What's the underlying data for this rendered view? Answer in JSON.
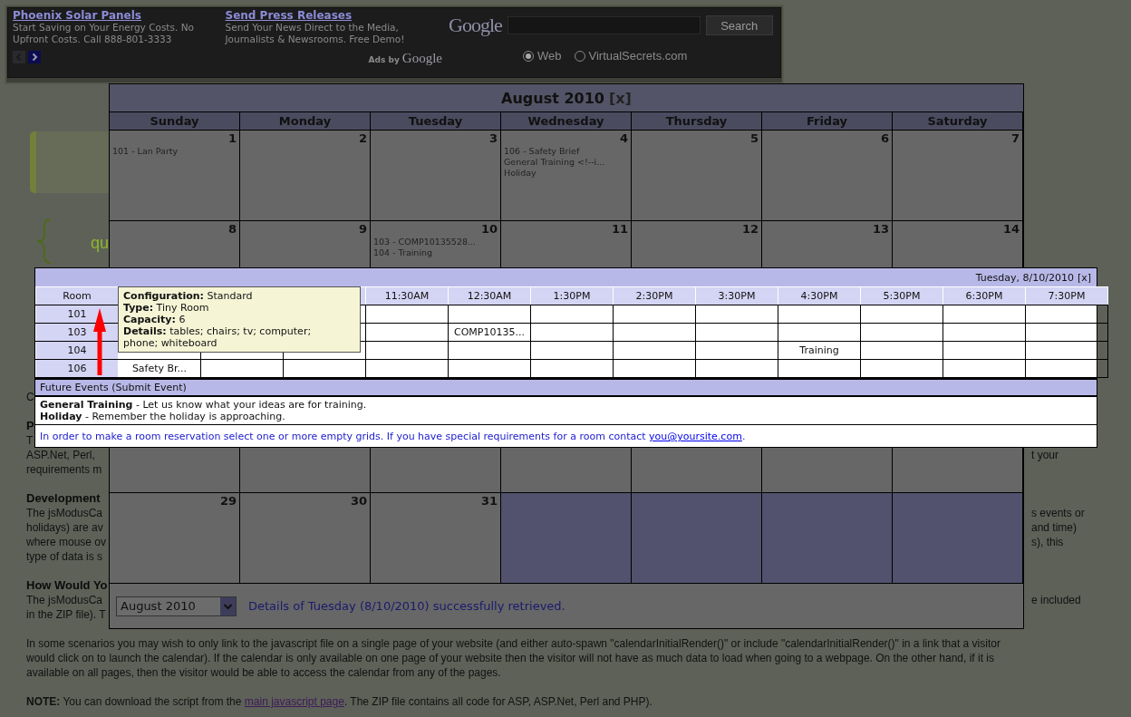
{
  "ad_bar": {
    "ads": [
      {
        "title": "Phoenix Solar Panels",
        "lines": [
          "Start Saving on Your Energy Costs. No",
          "Upfront Costs. Call 888-801-3333"
        ]
      },
      {
        "title": "Send Press Releases",
        "lines": [
          "Send Your News Direct to the Media,",
          "Journalists & Newsrooms. Free Demo!"
        ]
      }
    ],
    "ads_by": "Ads by",
    "ads_by_brand": "Google",
    "search": {
      "logo": "Google",
      "button": "Search",
      "options": [
        {
          "label": "Web",
          "selected": true
        },
        {
          "label": "VirtualSecrets.com",
          "selected": false
        }
      ]
    }
  },
  "page": {
    "heading_fragment": "qu",
    "blocks": [
      {
        "lines": [
          {
            "left": "C"
          }
        ]
      },
      {
        "heading": "P",
        "lines": [
          {
            "left": "T"
          },
          {
            "left": "ASP.Net, Perl,",
            "right": "t your"
          },
          {
            "left": "requirements m"
          }
        ]
      },
      {
        "heading": "Development",
        "lines": [
          {
            "left": "The jsModusCa",
            "right": "s events or"
          },
          {
            "left": "holidays) are av",
            "right": "and time)"
          },
          {
            "left": "where mouse ov",
            "right": "s), this"
          },
          {
            "left": "type of data is s"
          }
        ]
      },
      {
        "heading": "How Would Yo",
        "lines": [
          {
            "left": "The jsModusCa",
            "right": "e included"
          },
          {
            "left": "in the ZIP file). T"
          }
        ]
      },
      {
        "lines": [
          {
            "left": "In some scenarios you may wish to only link to the javascript file on a single page of your website (and either auto-spawn \"calendarInitialRender()\" or include \"calendarInitialRender()\" in a link that a visitor"
          },
          {
            "left": "would click on to launch the calendar). If the calendar is only available on one page of your website then the visitor will not have as much data to load when going to a webpage. On the other hand, if it is"
          },
          {
            "left": "available on all pages, then the visitor would be able to access the calendar from any of the pages."
          }
        ]
      }
    ],
    "note": {
      "before": "**NOTE:** You can download the script from the ",
      "link": "main javascript page",
      "after": ". The ZIP file contains all code for ASP, ASP.Net, Perl and PHP)."
    }
  },
  "calendar": {
    "title": "August 2010",
    "close": "[x]",
    "weekdays": [
      "Sunday",
      "Monday",
      "Tuesday",
      "Wednesday",
      "Thursday",
      "Friday",
      "Saturday"
    ],
    "weeks": [
      [
        {
          "day": "1",
          "in_month": true,
          "events": [
            "101 - Lan Party"
          ]
        },
        {
          "day": "2",
          "in_month": true
        },
        {
          "day": "3",
          "in_month": true
        },
        {
          "day": "4",
          "in_month": true,
          "events": [
            "106 - Safety Brief",
            "General Training <!--i...",
            "Holiday"
          ]
        },
        {
          "day": "5",
          "in_month": true
        },
        {
          "day": "6",
          "in_month": true
        },
        {
          "day": "7",
          "in_month": true
        }
      ],
      [
        {
          "day": "8",
          "in_month": true
        },
        {
          "day": "9",
          "in_month": true
        },
        {
          "day": "10",
          "in_month": true,
          "events": [
            "103 - COMP10135528...",
            "104 - Training"
          ]
        },
        {
          "day": "11",
          "in_month": true
        },
        {
          "day": "12",
          "in_month": true
        },
        {
          "day": "13",
          "in_month": true
        },
        {
          "day": "14",
          "in_month": true
        }
      ],
      [
        {
          "in_month": true
        },
        {
          "in_month": true
        },
        {
          "in_month": true
        },
        {
          "in_month": true
        },
        {
          "in_month": true
        },
        {
          "in_month": true
        },
        {
          "in_month": true
        }
      ],
      [
        {
          "day": "29",
          "in_month": true
        },
        {
          "day": "30",
          "in_month": true
        },
        {
          "day": "31",
          "in_month": true
        },
        {
          "in_month": false
        },
        {
          "in_month": false
        },
        {
          "in_month": false
        },
        {
          "in_month": false
        }
      ]
    ],
    "month_select": "August 2010",
    "status": "Details of Tuesday (8/10/2010) successfully retrieved."
  },
  "day_view": {
    "date": "Tuesday, 8/10/2010",
    "close": "[x]",
    "columns": [
      {
        "label": "Room"
      },
      {},
      {},
      {},
      {
        "label": "11:30AM"
      },
      {
        "label": "12:30AM"
      },
      {
        "label": "1:30PM"
      },
      {
        "label": "2:30PM"
      },
      {
        "label": "3:30PM"
      },
      {
        "label": "4:30PM"
      },
      {
        "label": "5:30PM"
      },
      {
        "label": "6:30PM"
      },
      {
        "label": "7:30PM"
      }
    ],
    "rows": [
      {
        "cells": [
          {
            "text": "101"
          },
          {},
          {},
          {},
          {},
          {},
          {},
          {},
          {},
          {},
          {},
          {},
          {}
        ]
      },
      {
        "cells": [
          {
            "text": "103"
          },
          {},
          {},
          {},
          {},
          {
            "text": "COMP10135..."
          },
          {},
          {},
          {},
          {},
          {},
          {},
          {}
        ]
      },
      {
        "cells": [
          {
            "text": "104"
          },
          {},
          {},
          {},
          {},
          {},
          {},
          {},
          {},
          {
            "text": "Training"
          },
          {},
          {},
          {}
        ]
      },
      {
        "cells": [
          {
            "text": "106"
          },
          {
            "text": "Safety Br..."
          },
          {},
          {},
          {},
          {},
          {},
          {},
          {},
          {},
          {},
          {},
          {}
        ]
      }
    ],
    "future_events": {
      "title": "Future Events (Submit Event)",
      "items": [
        "**General Training** - Let us know what your ideas are for training.",
        "**Holiday** - Remember the holiday is approaching."
      ]
    },
    "info": {
      "before": "In order to make a room reservation select one or more empty grids. If you have special requirements for a room contact ",
      "link": "you@yoursite.com",
      "after": "."
    },
    "tooltip": {
      "lines": [
        "**Configuration:** Standard",
        "**Type:** Tiny Room",
        "**Capacity:** 6",
        "**Details:** tables; chairs; tv; computer; phone; whiteboard"
      ]
    }
  }
}
